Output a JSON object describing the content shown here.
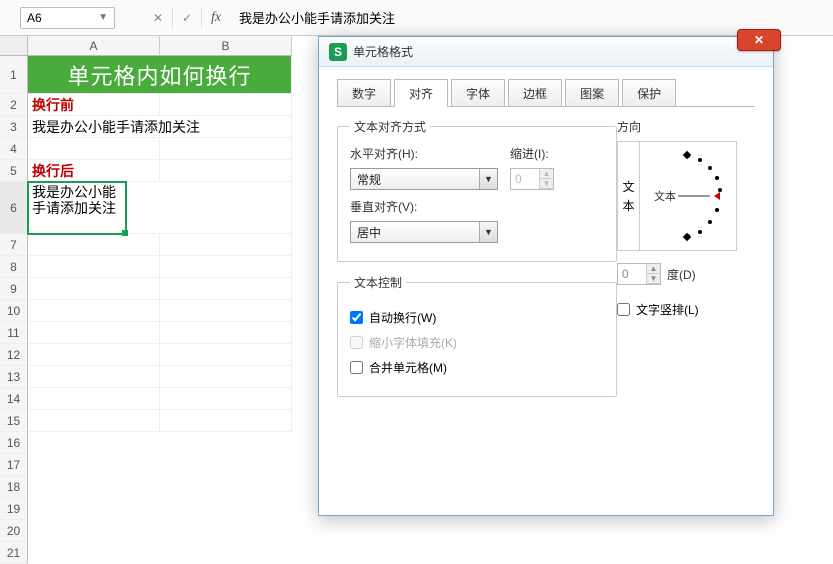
{
  "namebox": "A6",
  "formula": "我是办公小能手请添加关注",
  "columns": [
    "A",
    "B"
  ],
  "rows": [
    "1",
    "2",
    "3",
    "4",
    "5",
    "6",
    "7",
    "8",
    "9",
    "10",
    "11",
    "12",
    "13",
    "14",
    "15",
    "16",
    "17",
    "18",
    "19",
    "20",
    "21"
  ],
  "sheet": {
    "title": "单元格内如何换行",
    "before_label": "换行前",
    "before_text": "我是办公小能手请添加关注",
    "after_label": "换行后",
    "after_text": "我是办公小能手请添加关注"
  },
  "dialog": {
    "title": "单元格格式",
    "tabs": [
      "数字",
      "对齐",
      "字体",
      "边框",
      "图案",
      "保护"
    ],
    "active_tab": 1,
    "group_text_align": "文本对齐方式",
    "h_label": "水平对齐(H):",
    "h_value": "常规",
    "indent_label": "缩进(I):",
    "indent_value": "0",
    "v_label": "垂直对齐(V):",
    "v_value": "居中",
    "group_text_ctrl": "文本控制",
    "wrap_label": "自动换行(W)",
    "shrink_label": "缩小字体填充(K)",
    "merge_label": "合并单元格(M)",
    "orient_group": "方向",
    "orient_vertical": "文本",
    "orient_h_label": "文本",
    "degree_value": "0",
    "degree_label": "度(D)",
    "vertical_text_label": "文字竖排(L)"
  }
}
